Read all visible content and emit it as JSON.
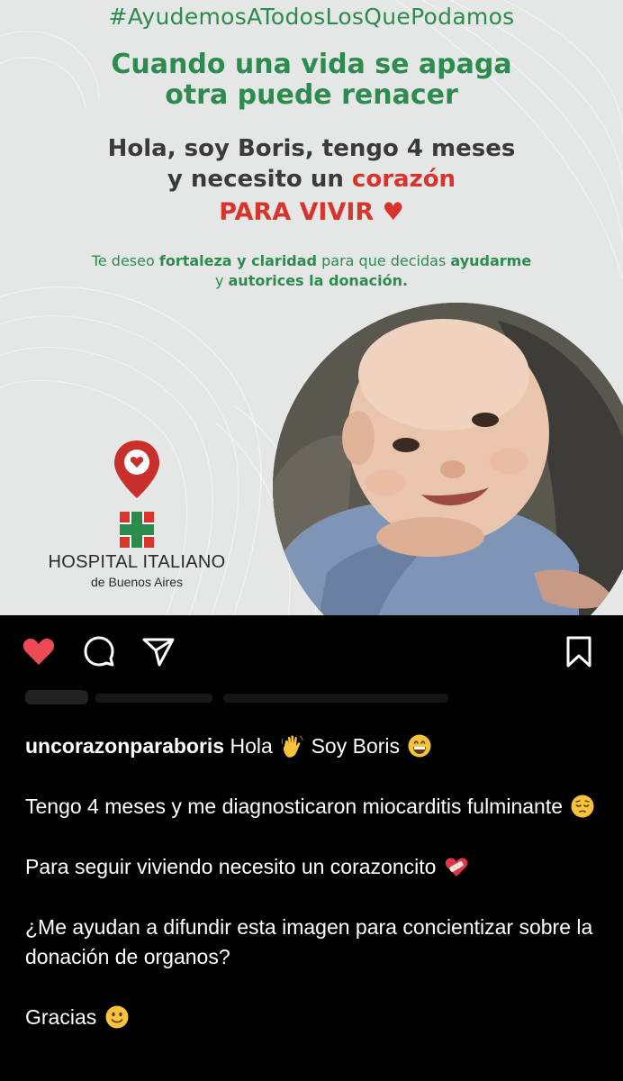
{
  "poster": {
    "hashtag": "#AyudemosATodosLosQuePodamos",
    "headline_line1": "Cuando una vida se apaga",
    "headline_line2": "otra puede renacer",
    "intro_line1": "Hola, soy Boris, tengo 4 meses",
    "intro_line2_a": "y necesito un ",
    "intro_line2_b": "corazón",
    "intro_line3": "PARA VIVIR ♥",
    "wish_line1_a": "Te deseo ",
    "wish_line1_b": "fortaleza y claridad",
    "wish_line1_c": " para que decidas ",
    "wish_line1_d": "ayudarme",
    "wish_line2_a": "y ",
    "wish_line2_b": "autorices la donación.",
    "hospital_name": "HOSPITAL ITALIANO",
    "hospital_sub": "de Buenos Aires",
    "colors": {
      "green": "#2e8b4e",
      "red": "#d9342b",
      "background": "#e4e7e6"
    },
    "icons": [
      "location-heart-pin-icon",
      "hospital-cross-logo"
    ]
  },
  "actions": {
    "like_icon": "heart-filled-icon",
    "comment_icon": "comment-bubble-icon",
    "share_icon": "paper-plane-icon",
    "save_icon": "bookmark-icon",
    "liked": true,
    "like_color": "#ed4956"
  },
  "caption": {
    "username": "uncorazonparaboris",
    "line1_text": " Hola ",
    "line1_emoji1": "waving-hand-emoji",
    "line1_text2": " Soy Boris ",
    "line1_emoji2": "grinning-face-emoji",
    "para2": "Tengo 4 meses y me diagnosticaron miocarditis fulminante ",
    "para2_emoji": "pensive-face-emoji",
    "para3": "Para seguir viviendo necesito un corazoncito ",
    "para3_emoji": "mending-heart-emoji",
    "para4": "¿Me ayudan a difundir esta imagen para concientizar sobre la donación de organos?",
    "para5": "Gracias ",
    "para5_emoji": "slightly-smiling-face-emoji"
  }
}
